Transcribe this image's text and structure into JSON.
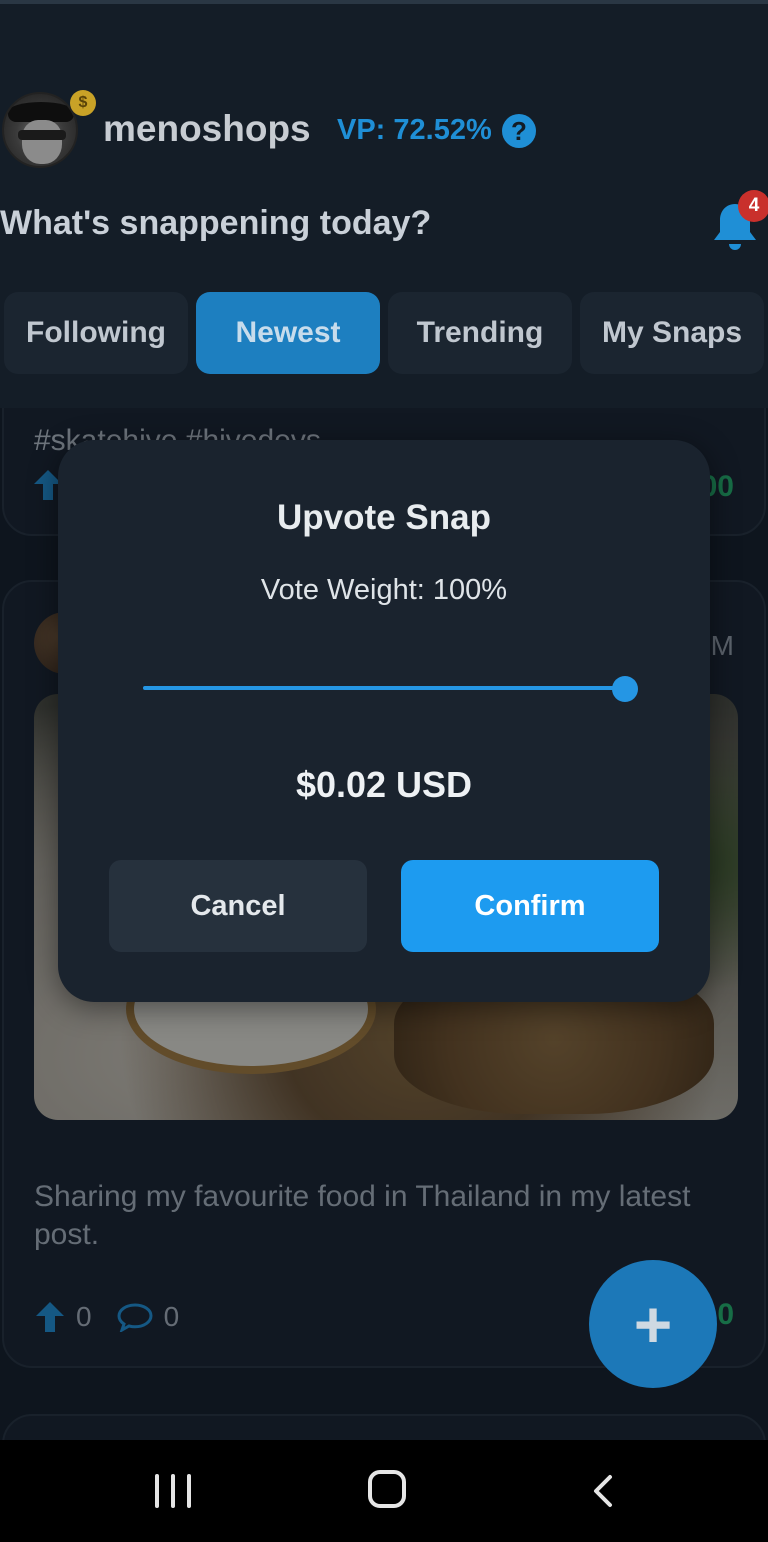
{
  "header": {
    "username": "menoshops",
    "vp_text": "VP: 72.52%",
    "help_glyph": "?",
    "coin_glyph": "$",
    "prompt": "What's snappening today?",
    "notifications_count": "4"
  },
  "tabs": [
    {
      "label": "Following",
      "active": false
    },
    {
      "label": "Newest",
      "active": true
    },
    {
      "label": "Trending",
      "active": false
    },
    {
      "label": "My Snaps",
      "active": false
    }
  ],
  "feed": {
    "card1": {
      "tags": "#skatehive #hivedevs",
      "payout_visible": "00"
    },
    "card2": {
      "time_visible": "M",
      "caption": "Sharing my favourite food in Thailand in my latest post.",
      "upvotes": "0",
      "comments": "0",
      "payout_visible": "0"
    }
  },
  "modal": {
    "title": "Upvote Snap",
    "vote_weight_text": "Vote Weight: 100%",
    "vote_weight": 1.0,
    "usd_value": "$0.02 USD",
    "cancel_label": "Cancel",
    "confirm_label": "Confirm"
  },
  "fab": {
    "glyph": "+"
  },
  "icons": {
    "help": "question-circle-icon",
    "bell": "bell-icon",
    "upvote": "arrow-up-icon",
    "comment": "speech-bubble-icon",
    "fab": "plus-icon",
    "nav_recents": "recents-icon",
    "nav_home": "home-icon",
    "nav_back": "back-icon"
  },
  "colors": {
    "accent": "#1d9bf0",
    "tab_active": "#1d7fc0",
    "payout_green": "#24b36b",
    "badge_red": "#c9302c",
    "background": "#131c26"
  }
}
